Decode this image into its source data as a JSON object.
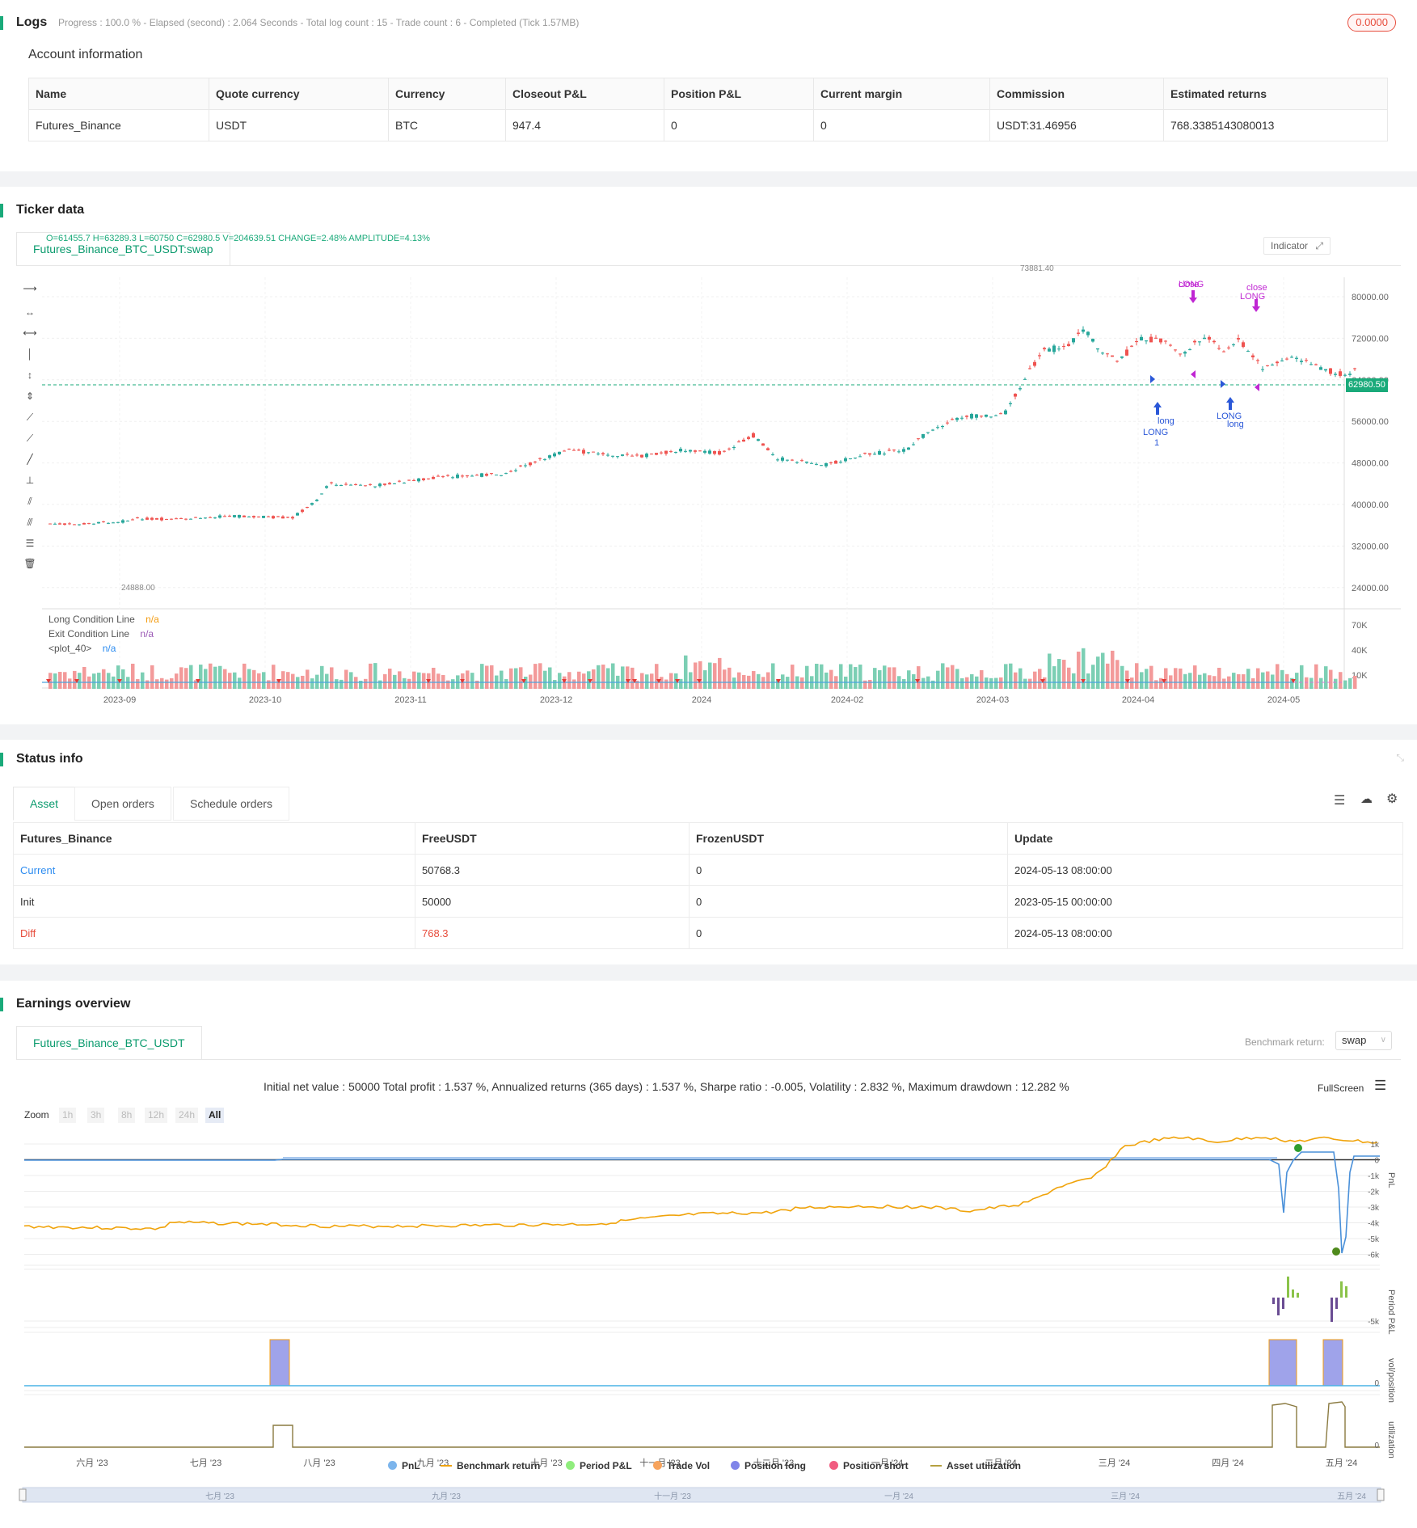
{
  "logs": {
    "title": "Logs",
    "progress_line": "Progress : 100.0 % - Elapsed (second) : 2.064  Seconds - Total log count : 15 - Trade count : 6 - Completed (Tick 1.57MB)",
    "badge": "0.0000"
  },
  "account": {
    "title": "Account information",
    "headers": [
      "Name",
      "Quote currency",
      "Currency",
      "Closeout P&L",
      "Position P&L",
      "Current margin",
      "Commission",
      "Estimated returns"
    ],
    "row": [
      "Futures_Binance",
      "USDT",
      "BTC",
      "947.4",
      "0",
      "0",
      "USDT:31.46956",
      "768.3385143080013"
    ]
  },
  "ticker": {
    "title": "Ticker data",
    "tab": "Futures_Binance_BTC_USDT:swap",
    "ohlc": "O=61455.7 H=63289.3 L=60750 C=62980.5 V=204639.51 CHANGE=2.48% AMPLITUDE=4.13%",
    "indicator_btn": "Indicator",
    "price_label": "62980.50",
    "high_label": "73881.40",
    "low_label": "24888.00",
    "y_ticks": [
      "80000.00",
      "72000.00",
      "64000.00",
      "56000.00",
      "48000.00",
      "40000.00",
      "32000.00",
      "24000.00"
    ],
    "vol_ticks": [
      "70K",
      "40K",
      "10K"
    ],
    "x_ticks": [
      "2023-09",
      "2023-10",
      "2023-11",
      "2023-12",
      "2024",
      "2024-02",
      "2024-03",
      "2024-04",
      "2024-05"
    ],
    "indicators": [
      {
        "name": "Long Condition Line",
        "value": "n/a",
        "color": "#f39c12"
      },
      {
        "name": "Exit Condition Line",
        "value": "n/a",
        "color": "#9b59b6"
      },
      {
        "name": "<plot_40>",
        "value": "n/a",
        "color": "#2d8cf0"
      }
    ],
    "signals": {
      "long": "long",
      "LONG": "LONG",
      "one": "1",
      "close": "close",
      "LONG_close": "LONG"
    }
  },
  "status": {
    "title": "Status info",
    "tabs": [
      "Asset",
      "Open orders",
      "Schedule orders"
    ],
    "headers": [
      "Futures_Binance",
      "FreeUSDT",
      "FrozenUSDT",
      "Update"
    ],
    "rows": [
      [
        "Current",
        "50768.3",
        "0",
        "2024-05-13 08:00:00"
      ],
      [
        "Init",
        "50000",
        "0",
        "2023-05-15 00:00:00"
      ],
      [
        "Diff",
        "768.3",
        "0",
        "2024-05-13 08:00:00"
      ]
    ]
  },
  "earnings": {
    "title": "Earnings overview",
    "tab": "Futures_Binance_BTC_USDT",
    "benchmark_label": "Benchmark return:",
    "benchmark_value": "swap",
    "summary": "Initial net value : 50000 Total profit : 1.537 %, Annualized returns (365 days) : 1.537 %, Sharpe ratio : -0.005, Volatility : 2.832 %, Maximum drawdown : 12.282 %",
    "fullscreen": "FullScreen",
    "zoom_label": "Zoom",
    "zoom_buttons": [
      "1h",
      "3h",
      "8h",
      "12h",
      "24h",
      "All"
    ],
    "pnl_ticks": [
      "1k",
      "0",
      "-1k",
      "-2k",
      "-3k",
      "-4k",
      "-5k",
      "-6k"
    ],
    "period_tick": "-5k",
    "vol_tick": "0",
    "util_tick": "0",
    "axis_titles": [
      "PnL",
      "Period P&L",
      "vol/position",
      "utilization"
    ],
    "x_ticks": [
      "六月 '23",
      "七月 '23",
      "八月 '23",
      "九月 '23",
      "十月 '23",
      "十一月 '23",
      "十二月 '23",
      "一月 '24",
      "二月 '24",
      "三月 '24",
      "四月 '24",
      "五月 '24"
    ],
    "nav_ticks": [
      "七月 '23",
      "九月 '23",
      "十一月 '23",
      "一月 '24",
      "三月 '24",
      "五月 '24"
    ],
    "legend": [
      {
        "label": "PnL",
        "color": "#7cb5ec"
      },
      {
        "label": "Benchmark return",
        "color": "#f0a30a"
      },
      {
        "label": "Period P&L",
        "color": "#90ed7d"
      },
      {
        "label": "Trade Vol",
        "color": "#f7a35c"
      },
      {
        "label": "Position long",
        "color": "#8085e9"
      },
      {
        "label": "Position short",
        "color": "#f15c80"
      },
      {
        "label": "Asset utilization",
        "color": "#b5a040"
      }
    ]
  }
}
